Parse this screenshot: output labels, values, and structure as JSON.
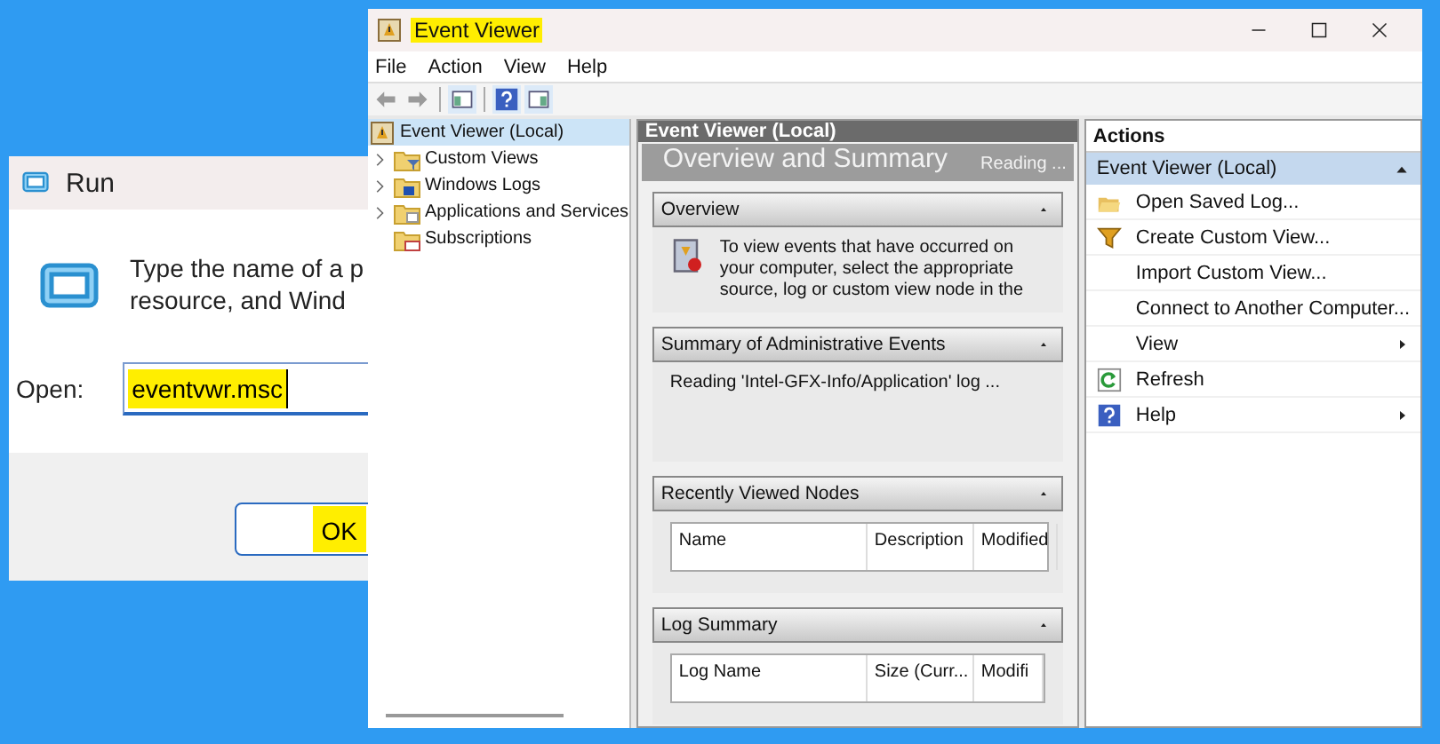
{
  "run_dialog": {
    "title": "Run",
    "prompt_lines": [
      "Type the name of a p",
      "resource, and Wind"
    ],
    "open_label": "Open:",
    "open_value": "eventvwr.msc",
    "ok_button": "OK"
  },
  "event_viewer": {
    "title": "Event Viewer",
    "menu": [
      "File",
      "Action",
      "View",
      "Help"
    ],
    "tree": [
      {
        "label": "Event Viewer (Local)",
        "selected": true,
        "kind": "root",
        "children": [
          {
            "label": "Custom Views",
            "selected": false,
            "kind": "filter-folder",
            "expandable": true
          },
          {
            "label": "Windows Logs",
            "selected": false,
            "kind": "log-folder",
            "expandable": true
          },
          {
            "label": "Applications and Services",
            "selected": false,
            "kind": "folder",
            "expandable": true
          },
          {
            "label": "Subscriptions",
            "selected": false,
            "kind": "subscription",
            "expandable": false
          }
        ]
      }
    ],
    "center": {
      "header": "Event Viewer (Local)",
      "banner": "Overview and Summary",
      "banner_status": "Reading ...",
      "sections": [
        {
          "title": "Overview",
          "kind": "text",
          "lines": [
            "To view events that have occurred on",
            "your computer, select the appropriate",
            "source, log or custom view node in the"
          ]
        },
        {
          "title": "Summary of Administrative Events",
          "kind": "status",
          "lines": [
            "Reading 'Intel-GFX-Info/Application' log ..."
          ]
        },
        {
          "title": "Recently Viewed Nodes",
          "kind": "table",
          "columns": [
            "Name",
            "Description",
            "Modified"
          ]
        },
        {
          "title": "Log Summary",
          "kind": "table",
          "columns": [
            "Log Name",
            "Size (Curr...",
            "Modifi"
          ]
        }
      ]
    },
    "actions": {
      "title": "Actions",
      "group": "Event Viewer (Local)",
      "items": [
        {
          "label": "Open Saved Log...",
          "kind": "folder",
          "submenu": false
        },
        {
          "label": "Create Custom View...",
          "kind": "filter",
          "submenu": false
        },
        {
          "label": "Import Custom View...",
          "kind": "none",
          "submenu": false
        },
        {
          "label": "Connect to Another Computer...",
          "kind": "none",
          "submenu": false
        },
        {
          "label": "View",
          "kind": "none",
          "submenu": true
        },
        {
          "label": "Refresh",
          "kind": "refresh",
          "submenu": false
        },
        {
          "label": "Help",
          "kind": "help",
          "submenu": true
        }
      ]
    }
  }
}
